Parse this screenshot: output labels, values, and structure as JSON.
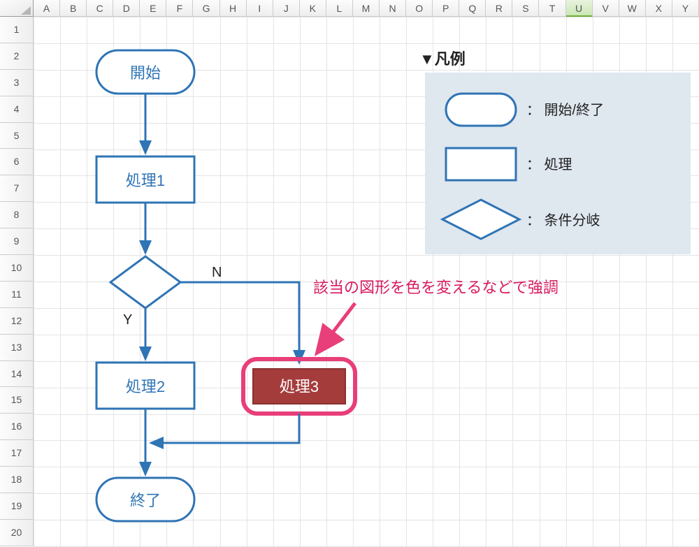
{
  "columns": [
    "A",
    "B",
    "C",
    "D",
    "E",
    "F",
    "G",
    "H",
    "I",
    "J",
    "K",
    "L",
    "M",
    "N",
    "O",
    "P",
    "Q",
    "R",
    "S",
    "T",
    "U",
    "V",
    "W",
    "X",
    "Y"
  ],
  "selected_column": "U",
  "rows": [
    "1",
    "2",
    "3",
    "4",
    "5",
    "6",
    "7",
    "8",
    "9",
    "10",
    "11",
    "12",
    "13",
    "14",
    "15",
    "16",
    "17",
    "18",
    "19",
    "20"
  ],
  "flowchart": {
    "start": "開始",
    "process1": "処理1",
    "process2": "処理2",
    "process3": "処理3",
    "end": "終了",
    "branchYes": "Y",
    "branchNo": "N"
  },
  "legend": {
    "title": "▼凡例",
    "startend_label": "：  開始/終了",
    "process_label": "：  処理",
    "decision_label": "：  条件分岐"
  },
  "annotation": "該当の図形を色を変えるなどで強調"
}
